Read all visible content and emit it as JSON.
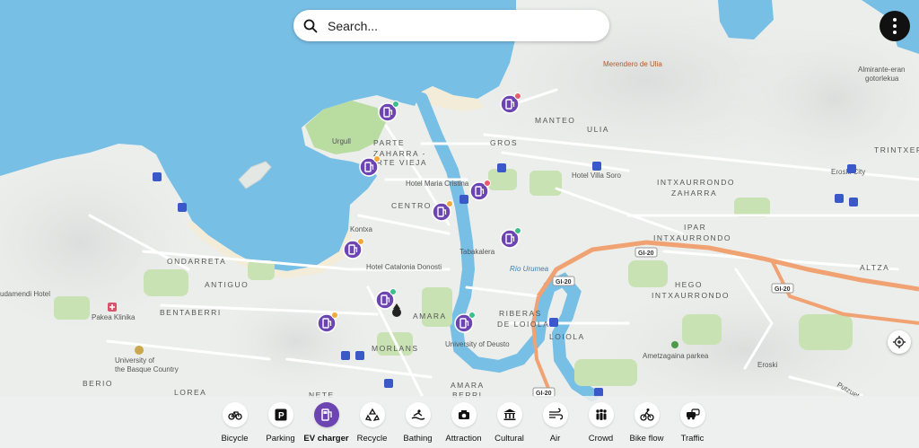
{
  "search": {
    "placeholder": "Search..."
  },
  "map_labels": {
    "merendero": "Merendero de Ulia",
    "almirante1": "Almirante-eran",
    "almirante2": "gotorlekua",
    "urgull": "Urgull",
    "parte1": "PARTE",
    "parte2": "ZAHARRA -",
    "parte3": "PARTE VIEJA",
    "gros": "GROS",
    "manteo": "MANTEO",
    "ulia": "ULIA",
    "trintxer": "TRINTXER",
    "eroski_city": "Eroski City",
    "villa_soro": "Hotel Villa Soro",
    "maria_cristina": "Hotel Maria Cristina",
    "intx_z1": "INTXAURRONDO",
    "intx_z2": "ZAHARRA",
    "centro": "CENTRO",
    "kontxa": "Kontxa",
    "ipar1": "IPAR",
    "ipar2": "INTXAURRONDO",
    "tabakalera": "Tabakalera",
    "rio": "Río Urumea",
    "ondarreta": "ONDARRETA",
    "catalonia": "Hotel Catalonia Donosti",
    "altza": "ALTZA",
    "hego1": "HEGO",
    "hego2": "INTXAURRONDO",
    "antiguo": "ANTIGUO",
    "udamendi": "udamendi Hotel",
    "pakea": "Pakea Klinika",
    "bentaberri": "BENTABERRI",
    "amara": "AMARA",
    "riberas1": "RIBERAS",
    "riberas2": "DE LOIOLA",
    "loiola": "LOIOLA",
    "deusto": "University of Deusto",
    "ametzagaina": "Ametzagaina parkea",
    "eroski": "Eroski",
    "univ1": "University of",
    "univ2": "the Basque Country",
    "morlans": "MORLANS",
    "berio": "BERIO",
    "lorea": "LOREA",
    "amara_berri1": "AMARA",
    "amara_berri2": "BERRI",
    "nete": "NETE",
    "putzuet": "Putzuet",
    "gi20a": "GI-20",
    "gi20b": "GI-20",
    "gi20c": "GI-20",
    "gi20d": "GI-20"
  },
  "ev_markers": [
    {
      "id": "ev-1",
      "status": "available"
    },
    {
      "id": "ev-2",
      "status": "busy"
    },
    {
      "id": "ev-3",
      "status": "partial"
    },
    {
      "id": "ev-4",
      "status": "busy"
    },
    {
      "id": "ev-5",
      "status": "partial"
    },
    {
      "id": "ev-6",
      "status": "available"
    },
    {
      "id": "ev-7",
      "status": "partial"
    },
    {
      "id": "ev-8",
      "status": "available"
    },
    {
      "id": "ev-9",
      "status": "partial"
    },
    {
      "id": "ev-10",
      "status": "available"
    }
  ],
  "status_colors": {
    "available": "#3dbf8a",
    "busy": "#e85d6a",
    "partial": "#f2a93b"
  },
  "accent_color": "#6c45b2",
  "categories": [
    {
      "label": "Bicycle",
      "icon": "bicycle-icon",
      "active": false
    },
    {
      "label": "Parking",
      "icon": "parking-icon",
      "active": false
    },
    {
      "label": "EV charger",
      "icon": "ev-charger-icon",
      "active": true
    },
    {
      "label": "Recycle",
      "icon": "recycle-icon",
      "active": false
    },
    {
      "label": "Bathing",
      "icon": "bathing-icon",
      "active": false
    },
    {
      "label": "Attraction",
      "icon": "attraction-icon",
      "active": false
    },
    {
      "label": "Cultural",
      "icon": "cultural-icon",
      "active": false
    },
    {
      "label": "Air",
      "icon": "air-icon",
      "active": false
    },
    {
      "label": "Crowd",
      "icon": "crowd-icon",
      "active": false
    },
    {
      "label": "Bike flow",
      "icon": "bike-flow-icon",
      "active": false
    },
    {
      "label": "Traffic",
      "icon": "traffic-icon",
      "active": false
    }
  ]
}
